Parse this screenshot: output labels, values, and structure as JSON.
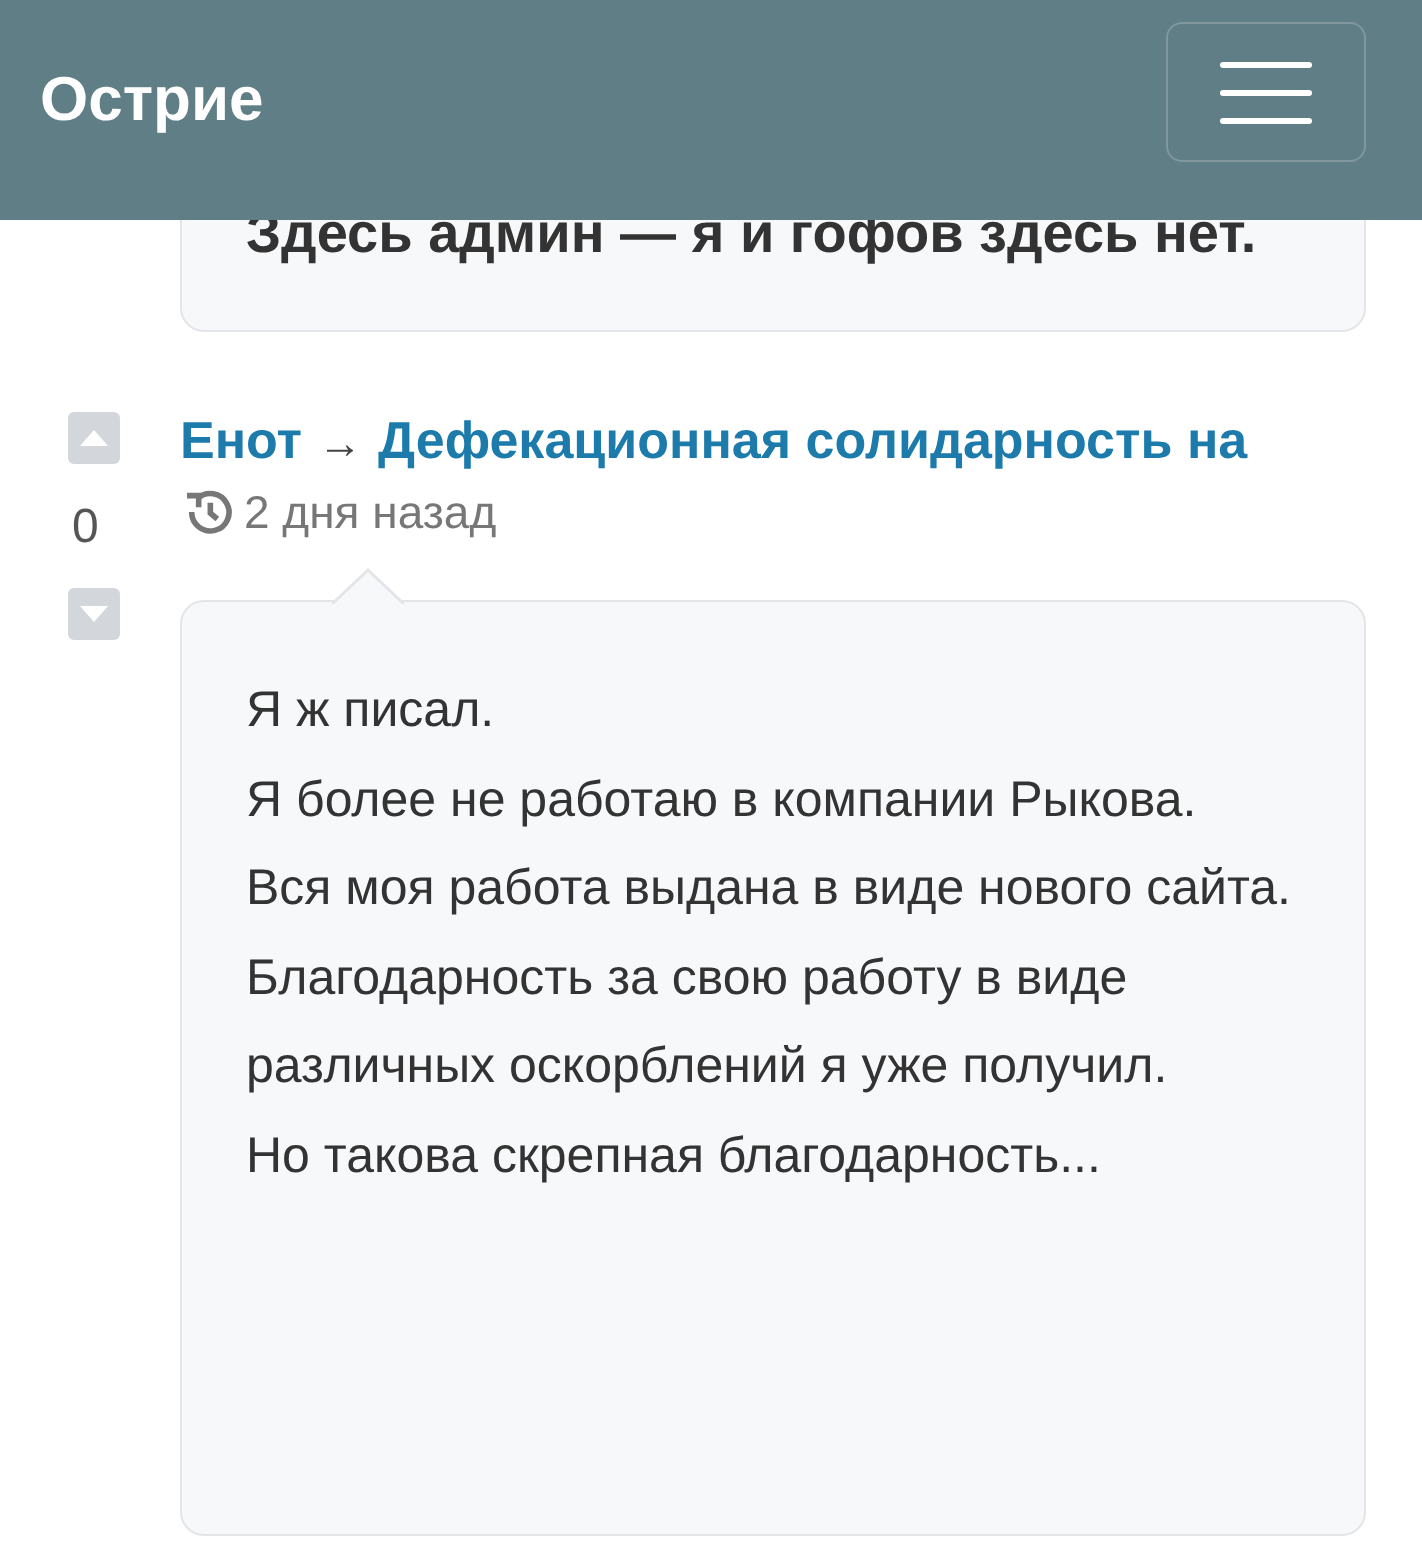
{
  "header": {
    "title": "Острие"
  },
  "previous_comment": {
    "text": "Здесь админ — я и гофов здесь нет."
  },
  "comment": {
    "votes": "0",
    "author": "Енот",
    "arrow": "→",
    "thread": "Дефекационная солидарность на",
    "time": "2 дня назад",
    "lines": [
      "Я ж писал.",
      "Я более не работаю в компании Рыкова.",
      "Вся моя работа выдана в виде нового сайта.",
      "Благодарность за свою работу в виде различных оскорблений я уже получил.",
      "Но такова скрепная благодарность..."
    ]
  }
}
